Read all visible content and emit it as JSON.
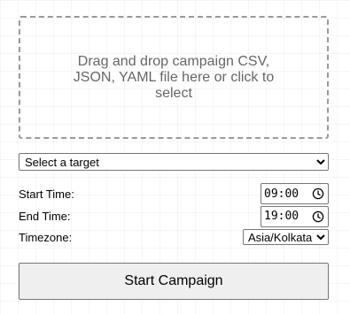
{
  "dropzone": {
    "text": "Drag and drop campaign CSV, JSON, YAML file here or click to select"
  },
  "target_select": {
    "selected": "Select a target",
    "options": [
      "Select a target"
    ]
  },
  "start_time": {
    "label": "Start Time:",
    "value": "09:00",
    "icon": "clock-icon"
  },
  "end_time": {
    "label": "End Time:",
    "value": "19:00",
    "icon": "clock-icon"
  },
  "timezone": {
    "label": "Timezone:",
    "selected": "Asia/Kolkata",
    "options": [
      "Asia/Kolkata"
    ]
  },
  "start_button": {
    "label": "Start Campaign"
  }
}
